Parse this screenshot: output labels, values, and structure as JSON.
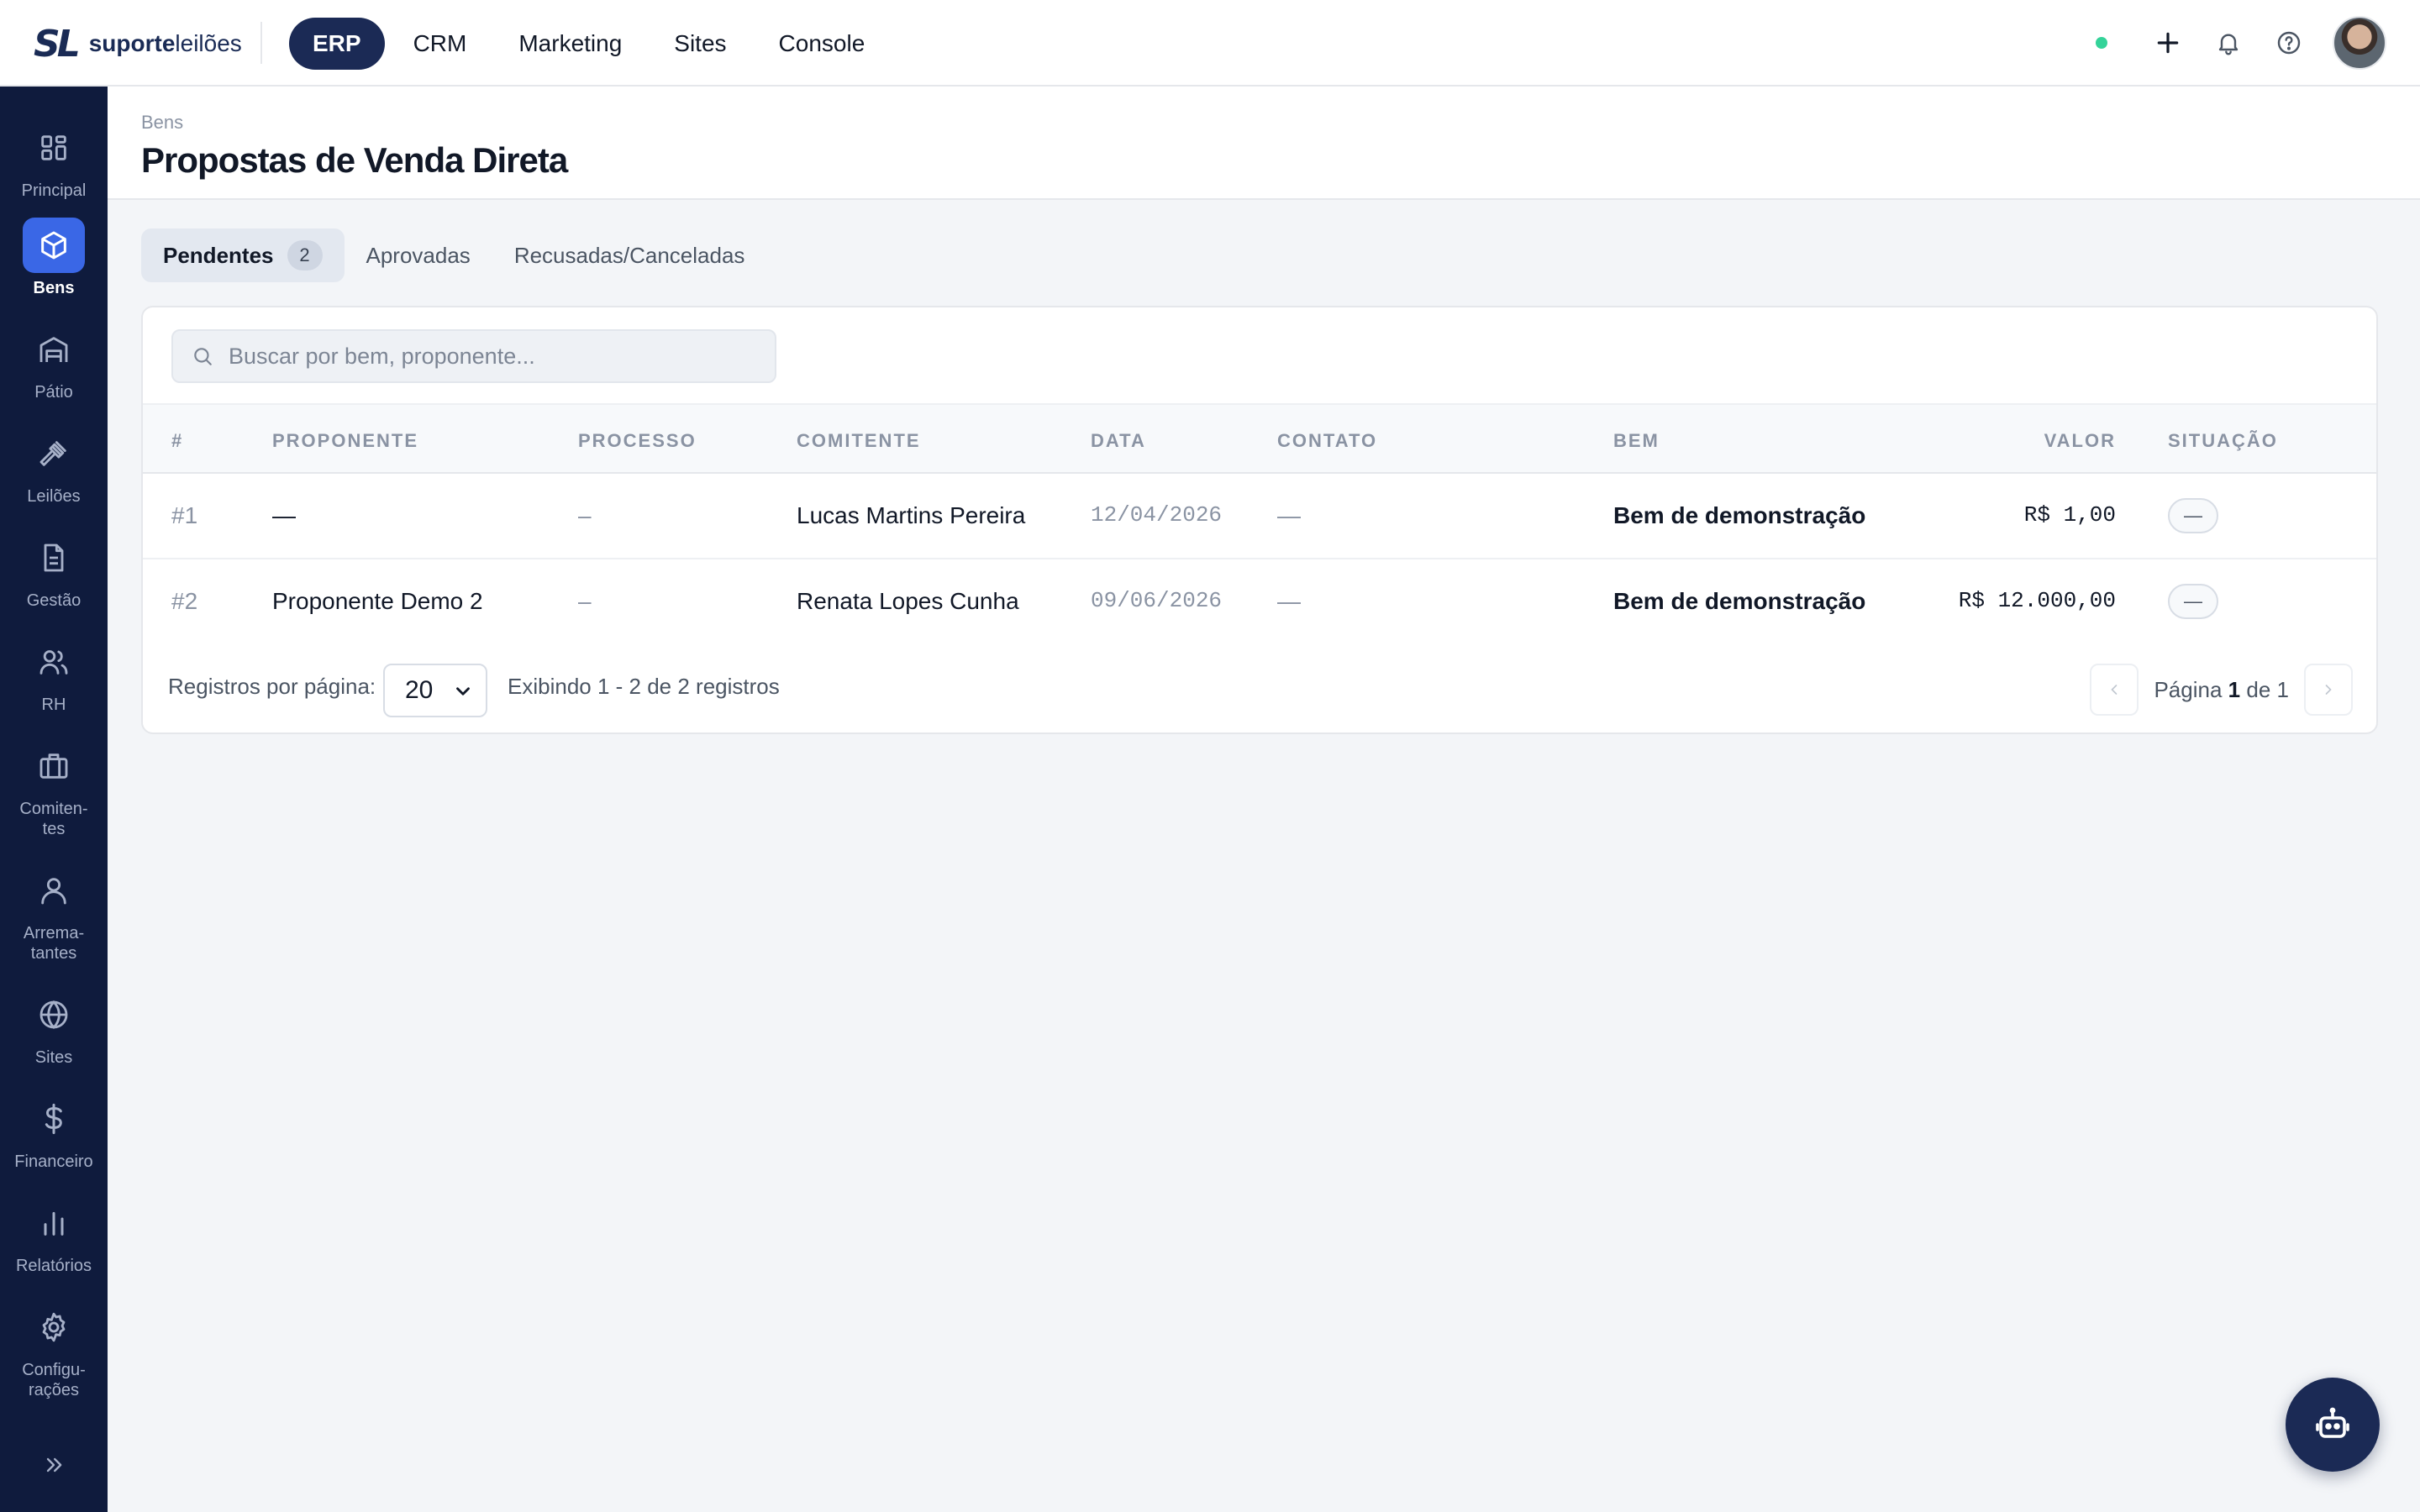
{
  "brand": {
    "mark": "SL",
    "name_bold": "suporte",
    "name_light": "leilões"
  },
  "topnav": [
    {
      "label": "ERP",
      "active": true
    },
    {
      "label": "CRM"
    },
    {
      "label": "Marketing"
    },
    {
      "label": "Sites"
    },
    {
      "label": "Console"
    }
  ],
  "topright": {
    "status_color": "#34d399",
    "icons": [
      "plus-icon",
      "bell-icon",
      "help-icon"
    ]
  },
  "sidebar": {
    "items": [
      {
        "label": "Principal",
        "icon": "grid-icon"
      },
      {
        "label": "Bens",
        "icon": "cube-icon",
        "active": true
      },
      {
        "label": "Pátio",
        "icon": "warehouse-icon"
      },
      {
        "label": "Leilões",
        "icon": "gavel-icon"
      },
      {
        "label": "Gestão",
        "icon": "document-icon"
      },
      {
        "label": "RH",
        "icon": "users-icon"
      },
      {
        "label": "Comiten-tes",
        "l1": "Comiten-",
        "l2": "tes",
        "icon": "briefcase-icon"
      },
      {
        "label": "Arrema-tantes",
        "l1": "Arrema-",
        "l2": "tantes",
        "icon": "user-icon"
      },
      {
        "label": "Sites",
        "icon": "globe-icon"
      },
      {
        "label": "Financeiro",
        "icon": "dollar-icon"
      },
      {
        "label": "Relatórios",
        "icon": "bar-chart-icon"
      },
      {
        "label": "Configu-rações",
        "l1": "Configu-",
        "l2": "rações",
        "icon": "gear-icon"
      }
    ],
    "accent": "#3a67e6",
    "background": "#0f1b3d"
  },
  "header": {
    "breadcrumb": "Bens",
    "title": "Propostas de Venda Direta"
  },
  "tabs": [
    {
      "label": "Pendentes",
      "count": "2",
      "active": true
    },
    {
      "label": "Aprovadas"
    },
    {
      "label": "Recusadas/Canceladas"
    }
  ],
  "search": {
    "placeholder": "Buscar por bem, proponente...",
    "value": ""
  },
  "table": {
    "columns": [
      "#",
      "PROPONENTE",
      "PROCESSO",
      "COMITENTE",
      "DATA",
      "CONTATO",
      "BEM",
      "VALOR",
      "SITUAÇÃO"
    ],
    "rows": [
      {
        "id": "#1",
        "proponente": "—",
        "processo": "–",
        "comitente": "Lucas Martins Pereira",
        "data": "12/04/2026",
        "contato": "—",
        "bem": "Bem de demonstração",
        "valor": "R$ 1,00",
        "situacao": "—"
      },
      {
        "id": "#2",
        "proponente": "Proponente Demo 2",
        "processo": "–",
        "comitente": "Renata Lopes Cunha",
        "data": "09/06/2026",
        "contato": "—",
        "bem": "Bem de demonstração",
        "valor": "R$ 12.000,00",
        "situacao": "—"
      }
    ]
  },
  "footer": {
    "per_page_label": "Registros por página:",
    "per_page_value": "20",
    "range_text": "Exibindo 1 - 2 de 2 registros",
    "page_label": "Página",
    "page_current": "1",
    "page_of": "de",
    "page_total": "1"
  },
  "assistant": {
    "icon": "robot-icon"
  }
}
